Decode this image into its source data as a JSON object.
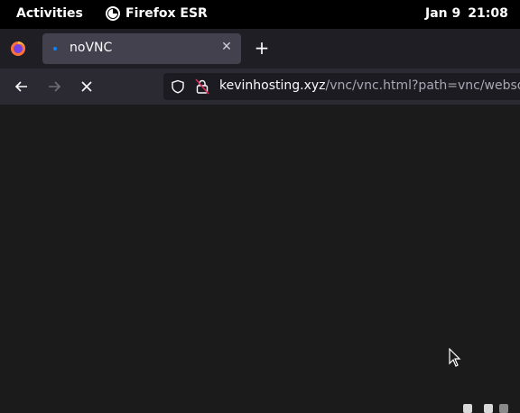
{
  "topbar": {
    "activities": "Activities",
    "app_name": "Firefox ESR",
    "date": "Jan 9",
    "time": "21:08"
  },
  "browser": {
    "tab": {
      "title": "noVNC",
      "close_glyph": "✕"
    },
    "new_tab_glyph": "+",
    "url_host": "kevinhosting.xyz",
    "url_path": "/vnc/vnc.html?path=vnc/websoc"
  },
  "colors": {
    "topbar_bg": "#000000",
    "tabstrip_bg": "#1f1e25",
    "active_tab_bg": "#42414d",
    "navbar_bg": "#2b2a33",
    "urlbar_bg": "#1c1b22",
    "content_bg": "#1c1b1c",
    "accent": "#0a84ff"
  },
  "icons": [
    "firefox-icon",
    "back-icon",
    "forward-icon",
    "stop-icon",
    "shield-icon",
    "lock-icon",
    "mouse-cursor-icon"
  ]
}
